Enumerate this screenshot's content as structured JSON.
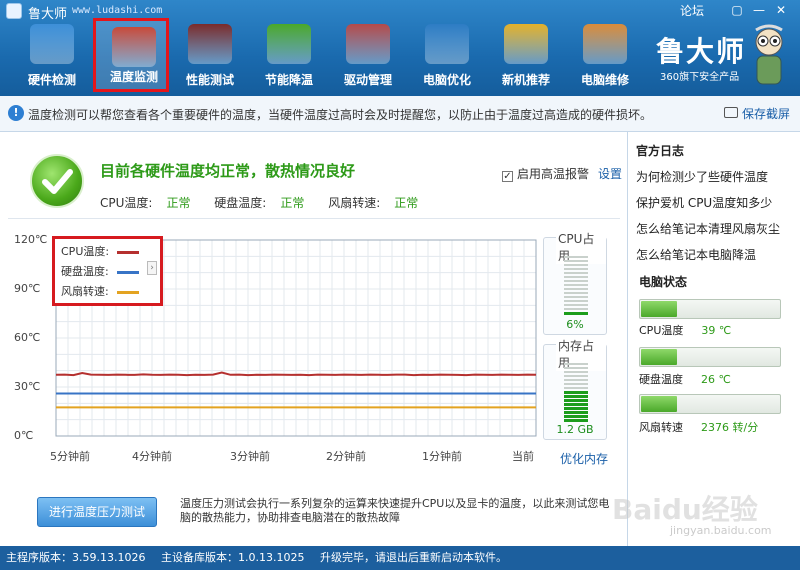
{
  "app": {
    "title": "鲁大师",
    "url": "www.ludashi.com",
    "forum": "论坛"
  },
  "brand": {
    "name": "鲁大师",
    "subtitle": "360旗下安全产品"
  },
  "nav": [
    {
      "label": "硬件检测",
      "icon": "monitor-magnifier-icon"
    },
    {
      "label": "温度监测",
      "icon": "thermometer-icon",
      "active": true
    },
    {
      "label": "性能测试",
      "icon": "speedometer-icon"
    },
    {
      "label": "节能降温",
      "icon": "clover-icon"
    },
    {
      "label": "驱动管理",
      "icon": "gear-box-icon"
    },
    {
      "label": "电脑优化",
      "icon": "screen-chart-icon"
    },
    {
      "label": "新机推荐",
      "icon": "award-medal-icon"
    },
    {
      "label": "电脑维修",
      "icon": "house-icon"
    }
  ],
  "info": {
    "text": "温度检测可以帮您查看各个重要硬件的温度，当硬件温度过高时会及时提醒您，以防止由于温度过高造成的硬件损坏。",
    "save": "保存截屏"
  },
  "status": {
    "title": "目前各硬件温度均正常，散热情况良好",
    "items": [
      {
        "label": "CPU温度:",
        "value": "正常"
      },
      {
        "label": "硬盘温度:",
        "value": "正常"
      },
      {
        "label": "风扇转速:",
        "value": "正常"
      }
    ],
    "alarm": "启用高温报警",
    "settings": "设置"
  },
  "chart_data": {
    "type": "line",
    "x": [
      "5分钟前",
      "4分钟前",
      "3分钟前",
      "2分钟前",
      "1分钟前",
      "当前"
    ],
    "yticks": [
      "120℃",
      "90℃",
      "60℃",
      "30℃",
      "0℃"
    ],
    "ylim": [
      0,
      120
    ],
    "series": [
      {
        "name": "CPU温度:",
        "color": "#b5302f",
        "values": [
          37.5,
          37.6,
          37.3,
          38.6,
          37.6,
          37.5,
          37.4,
          37.6,
          37.5,
          37.4,
          37.7,
          37.5,
          37.4,
          37.6,
          37.5,
          37.3,
          37.5,
          37.4,
          37.6,
          38.9,
          37.5,
          37.6,
          37.3,
          37.5,
          37.4,
          37.6,
          37.5,
          37.4,
          37.5,
          37.3,
          37.6,
          37.5,
          37.4,
          37.6,
          37.5,
          37.4,
          37.6,
          37.5,
          37.4,
          37.6,
          37.6,
          37.3,
          37.5,
          37.4,
          37.6,
          37.5,
          37.4,
          37.3,
          37.6,
          37.5,
          37.4,
          37.6,
          37.5,
          37.4,
          37.6,
          37.5
        ]
      },
      {
        "name": "硬盘温度:",
        "color": "#3874c6",
        "values": [
          26,
          26,
          26,
          26,
          26,
          26,
          26,
          26,
          26,
          26,
          26
        ]
      },
      {
        "name": "风扇转速:",
        "color": "#e3a321",
        "values": [
          17.5,
          17.5,
          17.5,
          17.5,
          17.5,
          17.5,
          17.5,
          17.5,
          17.5,
          17.5,
          17.5
        ]
      }
    ]
  },
  "gauges": {
    "cpu": {
      "title": "CPU占用",
      "value": "6%",
      "fraction": 0.06
    },
    "mem": {
      "title": "内存占用",
      "value": "1.2 GB",
      "fraction": 0.5
    },
    "optimize": "优化内存"
  },
  "stress": {
    "button": "进行温度压力测试",
    "desc": "温度压力测试会执行一系列复杂的运算来快速提升CPU以及显卡的温度，以此来测试您电脑的散热能力，协助排查电脑潜在的散热故障"
  },
  "sidebar": {
    "blog_title": "官方日志",
    "links": [
      "为何检测少了些硬件温度",
      "保护爱机 CPU温度知多少",
      "怎么给笔记本清理风扇灰尘",
      "怎么给笔记本电脑降温"
    ],
    "pc_status_title": "电脑状态",
    "rows": [
      {
        "label": "CPU温度",
        "value": "39 ℃",
        "fraction": 0.26
      },
      {
        "label": "硬盘温度",
        "value": "26 ℃",
        "fraction": 0.26
      },
      {
        "label": "风扇转速",
        "value": "2376 转/分",
        "fraction": 0.26
      }
    ]
  },
  "statusbar": {
    "main_version": "主程序版本：3.59.13.1026",
    "db_version": "主设备库版本：1.0.13.1025",
    "update": "升级完毕，请退出后重新启动本软件。"
  },
  "watermark": {
    "text": "Baidu经验",
    "sub": "jingyan.baidu.com"
  },
  "colors": {
    "header": "#1a6aae",
    "accent_green": "#2d9a18",
    "highlight_red": "#d61a1f"
  }
}
